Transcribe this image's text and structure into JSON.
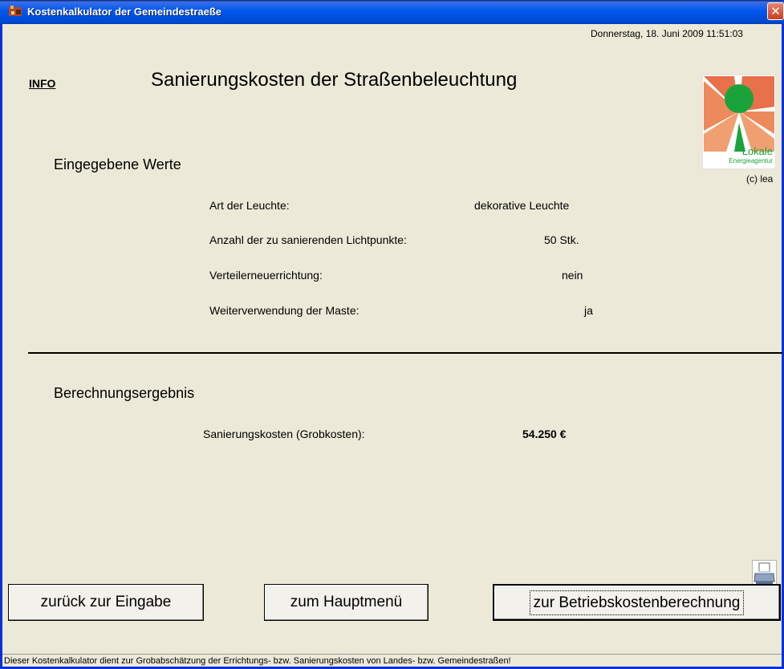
{
  "window": {
    "title": "Kostenkalkulator der Gemeindestraeße",
    "close_glyph": "✕"
  },
  "header": {
    "datetime": "Donnerstag, 18. Juni 2009   11:51:03",
    "info_link": "INFO",
    "page_title": "Sanierungskosten der Straßenbeleuchtung",
    "logo_text_main": "Lokale",
    "logo_text_sub": "Energieagentur",
    "copyright": "(c) lea"
  },
  "inputs_section": {
    "title": "Eingegebene Werte",
    "rows": [
      {
        "label": "Art der Leuchte:",
        "value": "dekorative Leuchte"
      },
      {
        "label": "Anzahl der zu sanierenden Lichtpunkte:",
        "value": "50  Stk."
      },
      {
        "label": "Verteilerneuerrichtung:",
        "value": "nein"
      },
      {
        "label": "Weiterverwendung der Maste:",
        "value": "ja"
      }
    ]
  },
  "result_section": {
    "title": "Berechnungsergebnis",
    "label": "Sanierungskosten (Grobkosten):",
    "value": "54.250  €"
  },
  "buttons": {
    "back": "zurück zur Eingabe",
    "main_menu": "zum Hauptmenü",
    "operating_costs": "zur Betriebskostenberechnung"
  },
  "status_bar": "Dieser Kostenkalkulator dient zur Grobabschätzung der Errichtungs- bzw. Sanierungskosten von Landes- bzw. Gemeindestraßen!",
  "icons": [
    "app-icon",
    "close-icon",
    "printer-icon",
    "logo-sun"
  ],
  "colors": {
    "titlebar": "#0058ee",
    "window_bg": "#ece9d8",
    "logo_green": "#1aa33a",
    "logo_orange": "#e8704a"
  }
}
